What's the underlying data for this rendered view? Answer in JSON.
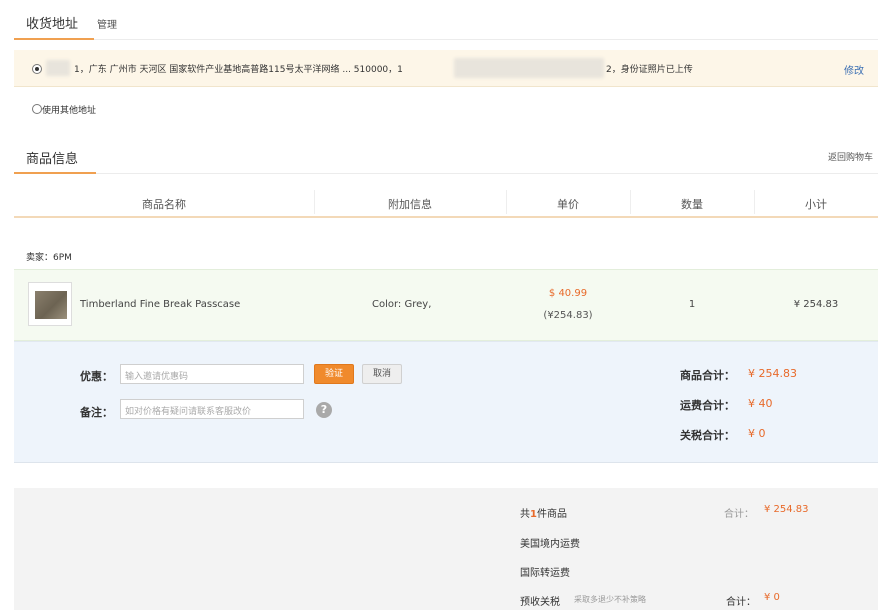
{
  "address_section": {
    "title": "收货地址",
    "manage_link": "管理",
    "selected_address": {
      "text": "1，广东 广州市 天河区 国家软件产业基地高普路115号太平洋网络 ... 510000，1",
      "text_suffix": "2，身份证照片已上传",
      "edit_link": "修改"
    },
    "other_address_label": "使用其他地址"
  },
  "product_section": {
    "title": "商品信息",
    "back_to_cart": "返回购物车",
    "columns": [
      "商品名称",
      "附加信息",
      "单价",
      "数量",
      "小计"
    ],
    "seller_label": "卖家：6PM",
    "item": {
      "name": "Timberland Fine Break Passcase",
      "extra_info": "Color: Grey,",
      "price_usd": "$ 40.99",
      "price_cny": "(¥254.83)",
      "quantity": "1",
      "subtotal": "¥ 254.83"
    }
  },
  "coupon_area": {
    "coupon_label": "优惠：",
    "coupon_placeholder": "输入邀请优惠码",
    "verify_button": "验证",
    "cancel_button": "取消",
    "note_label": "备注：",
    "note_placeholder": "如对价格有疑问请联系客服改价",
    "help_icon": "?",
    "summary": [
      {
        "label": "商品合计：",
        "value": "¥ 254.83"
      },
      {
        "label": "运费合计：",
        "value": "¥ 40"
      },
      {
        "label": "关税合计：",
        "value": "¥ 0"
      }
    ]
  },
  "bottom_summary": {
    "item_count_prefix": "共",
    "item_count": "1",
    "item_count_suffix": "件商品",
    "total_label": "合计：",
    "total_value": "¥ 254.83",
    "domestic_shipping": "美国境内运费",
    "international_shipping": "国际转运费",
    "prepaid_tax": "预收关税",
    "prepaid_tax_note": "采取多退少不补策略",
    "tax_total_label": "合计：",
    "tax_total_value": "¥ 0"
  },
  "colors": {
    "accent_orange": "#f0a050",
    "price_red": "#e86a2a",
    "link_blue": "#3b6fb3"
  }
}
